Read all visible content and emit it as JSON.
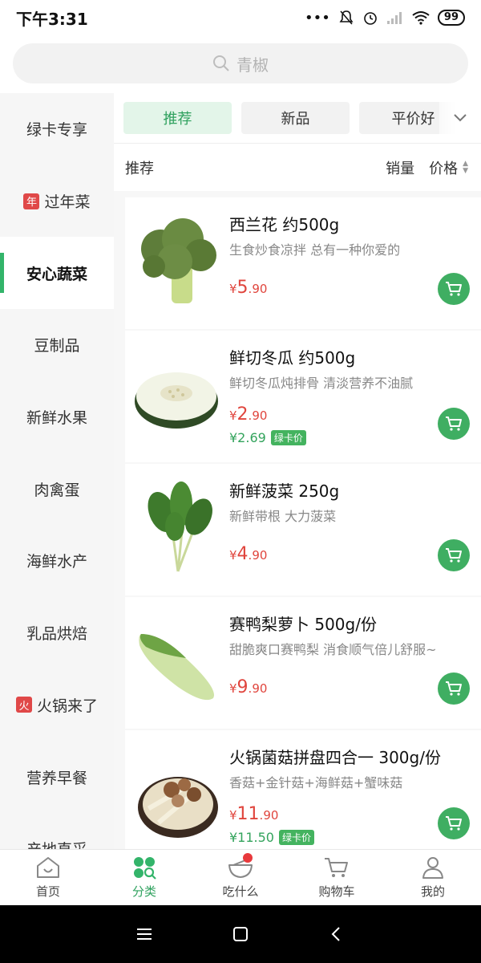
{
  "status_bar": {
    "time": "下午3:31",
    "battery": "99"
  },
  "search": {
    "placeholder": "青椒"
  },
  "sidebar": {
    "items": [
      {
        "label": "绿卡专享",
        "badge": ""
      },
      {
        "label": "过年菜",
        "badge": "年"
      },
      {
        "label": "安心蔬菜",
        "badge": "",
        "active": true
      },
      {
        "label": "豆制品",
        "badge": ""
      },
      {
        "label": "新鲜水果",
        "badge": ""
      },
      {
        "label": "肉禽蛋",
        "badge": ""
      },
      {
        "label": "海鲜水产",
        "badge": ""
      },
      {
        "label": "乳品烘焙",
        "badge": ""
      },
      {
        "label": "火锅来了",
        "badge": "火"
      },
      {
        "label": "营养早餐",
        "badge": ""
      },
      {
        "label": "产地直采",
        "badge": ""
      }
    ]
  },
  "tabs": [
    {
      "label": "推荐",
      "active": true
    },
    {
      "label": "新品"
    },
    {
      "label": "平价好"
    }
  ],
  "sortbar": {
    "left": "推荐",
    "sales": "销量",
    "price": "价格"
  },
  "products": [
    {
      "name": "西兰花 约500g",
      "desc": "生食炒食凉拌 总有一种你爱的",
      "yen": "¥",
      "price_int": "5",
      "price_dec": ".90",
      "card_price": "",
      "card_tag": ""
    },
    {
      "name": "鲜切冬瓜 约500g",
      "desc": "鲜切冬瓜炖排骨 清淡营养不油腻",
      "yen": "¥",
      "price_int": "2",
      "price_dec": ".90",
      "card_price": "¥2.69",
      "card_tag": "绿卡价"
    },
    {
      "name": "新鲜菠菜 250g",
      "desc": "新鲜带根 大力菠菜",
      "yen": "¥",
      "price_int": "4",
      "price_dec": ".90",
      "card_price": "",
      "card_tag": ""
    },
    {
      "name": "赛鸭梨萝卜 500g/份",
      "desc": "甜脆爽口赛鸭梨 消食顺气倍儿舒服~",
      "yen": "¥",
      "price_int": "9",
      "price_dec": ".90",
      "card_price": "",
      "card_tag": ""
    },
    {
      "name": "火锅菌菇拼盘四合一 300g/份",
      "desc": "香菇+金针菇+海鲜菇+蟹味菇",
      "yen": "¥",
      "price_int": "11",
      "price_dec": ".90",
      "card_price": "¥11.50",
      "card_tag": "绿卡价"
    }
  ],
  "bottom_nav": [
    {
      "label": "首页",
      "icon": "home-icon"
    },
    {
      "label": "分类",
      "icon": "category-icon",
      "active": true
    },
    {
      "label": "吃什么",
      "icon": "bowl-icon",
      "dot": true
    },
    {
      "label": "购物车",
      "icon": "cart-icon"
    },
    {
      "label": "我的",
      "icon": "profile-icon"
    }
  ],
  "colors": {
    "accent": "#3fae62",
    "price": "#e0453d",
    "badge": "#e04848"
  }
}
